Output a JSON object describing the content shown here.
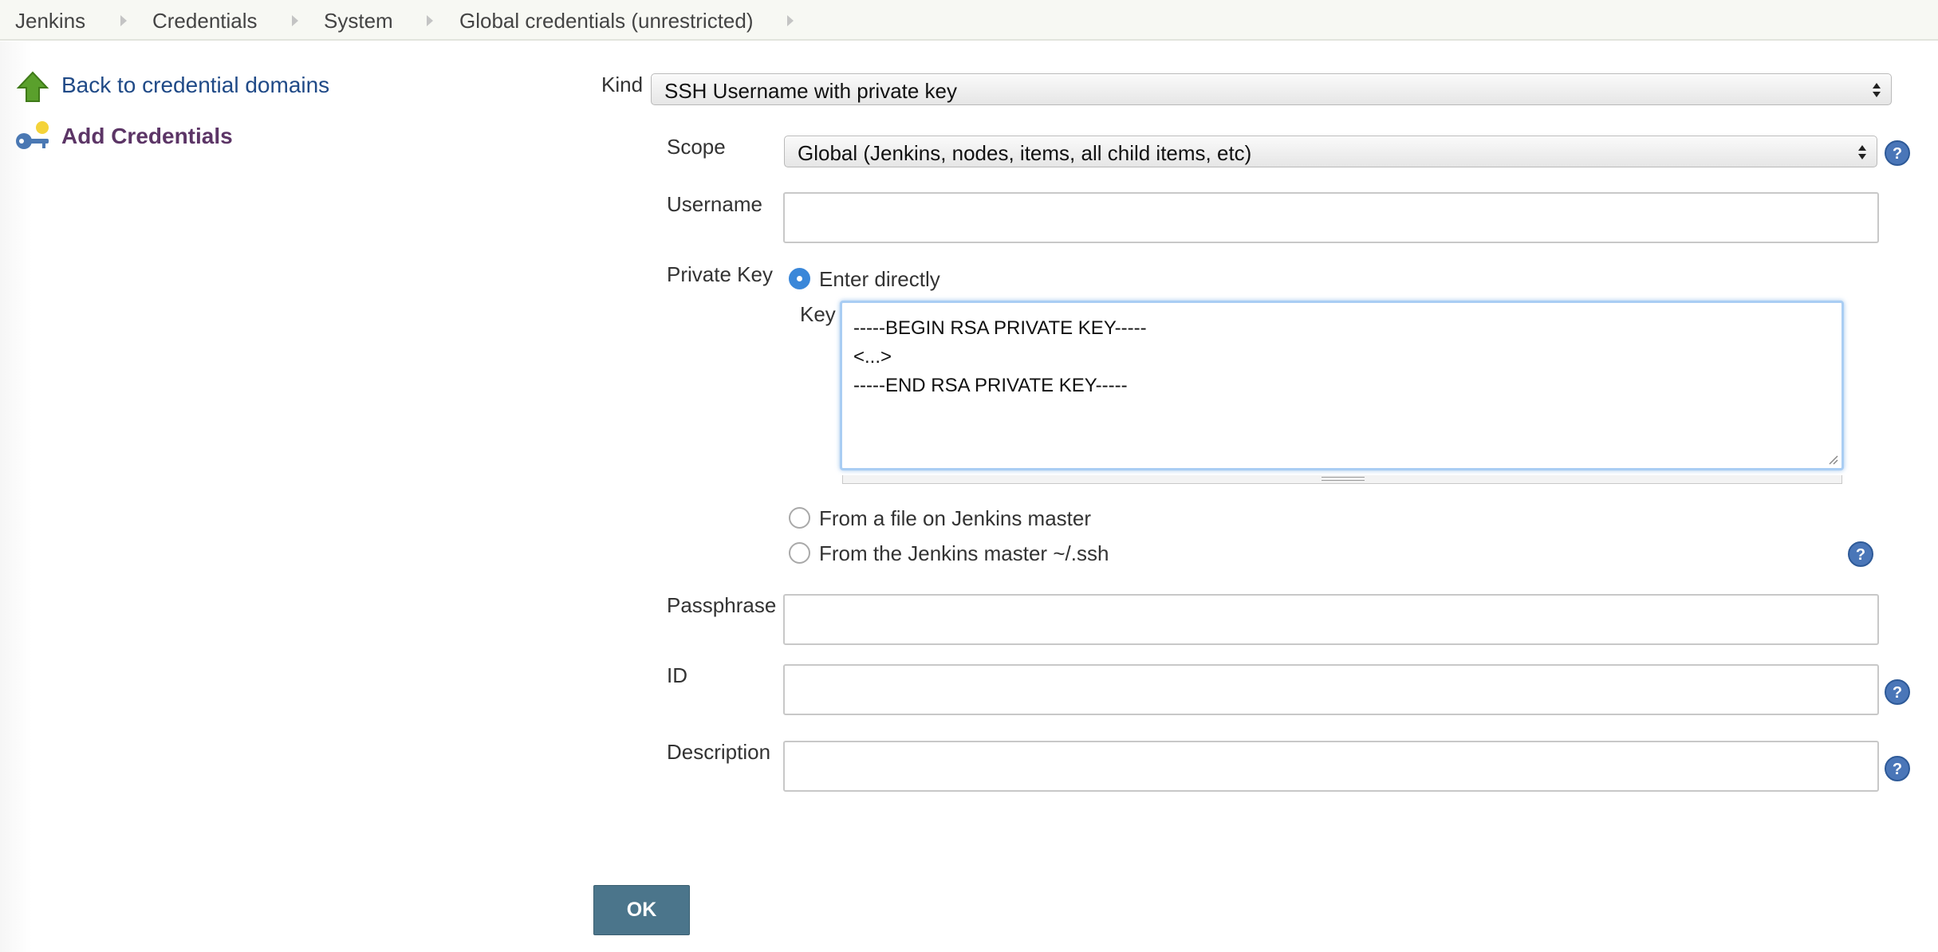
{
  "breadcrumb": {
    "items": [
      "Jenkins",
      "Credentials",
      "System",
      "Global credentials (unrestricted)"
    ]
  },
  "side_panel": {
    "back_link": "Back to credential domains",
    "add_credentials": "Add Credentials"
  },
  "form": {
    "kind": {
      "label": "Kind",
      "value": "SSH Username with private key"
    },
    "scope": {
      "label": "Scope",
      "value": "Global (Jenkins, nodes, items, all child items, etc)"
    },
    "username": {
      "label": "Username",
      "value": ""
    },
    "private_key": {
      "label": "Private Key",
      "options": {
        "enter_directly": "Enter directly",
        "from_file": "From a file on Jenkins master",
        "from_ssh": "From the Jenkins master ~/.ssh"
      },
      "selected": "enter_directly",
      "key_label": "Key",
      "key_lines": [
        "-----BEGIN RSA PRIVATE KEY-----",
        "<...>",
        "-----END RSA PRIVATE KEY-----"
      ]
    },
    "passphrase": {
      "label": "Passphrase",
      "value": ""
    },
    "id": {
      "label": "ID",
      "value": ""
    },
    "description": {
      "label": "Description",
      "value": ""
    }
  },
  "buttons": {
    "ok": "OK"
  },
  "colors": {
    "link": "#204a87",
    "active_side_item": "#5c3566",
    "ok_button": "#4b758b",
    "radio_selected": "#3a87d9",
    "help_icon": "#4a76b8"
  }
}
